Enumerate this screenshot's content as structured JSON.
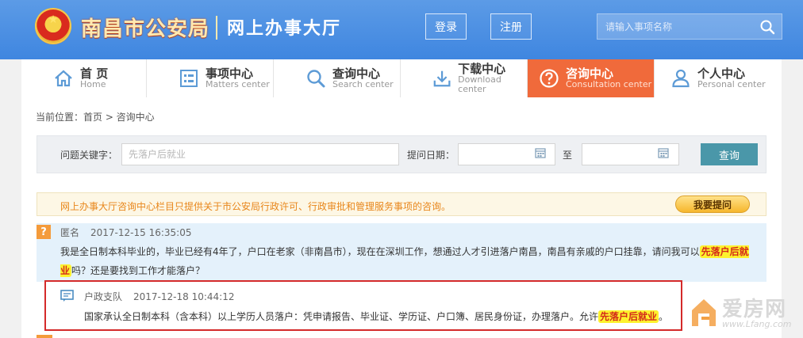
{
  "header": {
    "site_name": "南昌市公安局",
    "site_sub": "网上办事大厅",
    "login": "登录",
    "register": "注册",
    "search_placeholder": "请输入事项名称"
  },
  "nav": [
    {
      "cn": "首 页",
      "en": "Home",
      "icon": "home-icon"
    },
    {
      "cn": "事项中心",
      "en": "Matters center",
      "icon": "list-icon"
    },
    {
      "cn": "查询中心",
      "en": "Search center",
      "icon": "magnifier-icon"
    },
    {
      "cn": "下载中心",
      "en": "Download center",
      "icon": "download-icon"
    },
    {
      "cn": "咨询中心",
      "en": "Consultation center",
      "icon": "question-icon",
      "active": true
    },
    {
      "cn": "个人中心",
      "en": "Personal center",
      "icon": "person-icon"
    }
  ],
  "breadcrumb": "当前位置：首页 > 咨询中心",
  "filter": {
    "keyword_label": "问题关键字：",
    "keyword_placeholder": "先落户后就业",
    "date_label": "提问日期：",
    "to_label": "至",
    "query_button": "查询"
  },
  "notice": {
    "text": "网上办事大厅咨询中心栏目只提供关于市公安局行政许可、行政审批和管理服务事项的咨询。",
    "ask_button": "我要提问"
  },
  "question": {
    "badge": "?",
    "author": "匿名",
    "time": "2017-12-15 16:35:05",
    "text_before": "我是全日制本科毕业的，毕业已经有4年了，户口在老家（非南昌市），现在在深圳工作，想通过人才引进落户南昌，南昌有亲戚的户口挂靠，请问我可以",
    "highlight": "先落户后就业",
    "text_after": "吗？还是要找到工作才能落户？"
  },
  "answer": {
    "author": "户政支队",
    "time": "2017-12-18 10:44:12",
    "text_before": "国家承认全日制本科（含本科）以上学历人员落户：凭申请报告、毕业证、学历证、户口簿、居民身份证，办理落户。允许",
    "highlight": "先落户后就业",
    "text_after": "。"
  },
  "watermark": {
    "title": "爱房网",
    "url": "www.Lfang.com"
  },
  "colors": {
    "header_blue": "#4a8fe4",
    "active_orange": "#f06a3b",
    "query_teal": "#4a97a9",
    "notice_orange": "#e8861a",
    "highlight_yellow": "#fdf22e",
    "frame_red": "#d42a2a"
  }
}
